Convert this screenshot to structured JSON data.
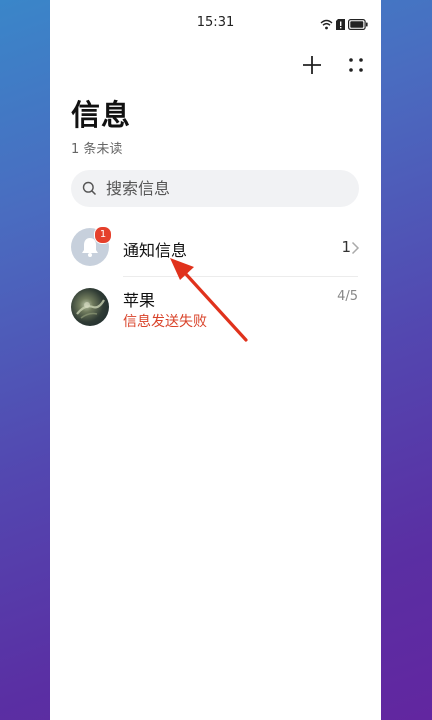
{
  "status_bar": {
    "time": "15:31"
  },
  "header": {
    "title": "信息",
    "unread": "1 条未读"
  },
  "search": {
    "placeholder": "搜索信息"
  },
  "conversations": [
    {
      "name": "通知信息",
      "badge": "1",
      "count": "1",
      "avatar_icon": "bell-icon"
    },
    {
      "name": "苹果",
      "date": "4/5",
      "subtitle": "信息发送失败",
      "avatar_icon": "contact-photo"
    }
  ],
  "colors": {
    "badge": "#e5402c",
    "error_text": "#d9432a",
    "annotation_arrow": "#e0321c"
  }
}
